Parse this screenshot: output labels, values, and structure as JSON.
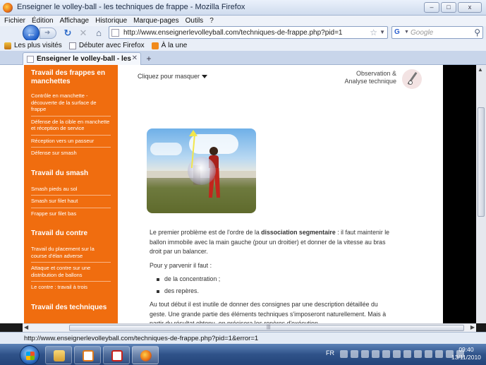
{
  "window": {
    "title": "Enseigner le volley-ball - les techniques de frappe - Mozilla Firefox",
    "buttons": {
      "minimize": "–",
      "maximize": "□",
      "close": "x"
    }
  },
  "menubar": {
    "items": [
      "Fichier",
      "Édition",
      "Affichage",
      "Historique",
      "Marque-pages",
      "Outils",
      "?"
    ]
  },
  "navigation": {
    "url": "http://www.enseignerlevolleyball.com/techniques-de-frappe.php?pid=1",
    "search_placeholder": "Google",
    "search_engine_glyph": "G"
  },
  "bookmarks": {
    "items": [
      "Les plus visités",
      "Débuter avec Firefox",
      "À la une"
    ]
  },
  "tabs": {
    "items": [
      {
        "label": "Enseigner le volley-ball - les techniqu..."
      }
    ],
    "new_tab": "+"
  },
  "sidebar": {
    "sections": [
      {
        "heading": "Travail des frappes en manchettes",
        "items": [
          "Contrôle en manchette - découverte de la surface de frappe",
          "Défense de la cible en manchette et réception de service",
          "Réception vers un passeur",
          "Défense sur smash"
        ]
      },
      {
        "heading": "Travail du smash",
        "items": [
          "Smash pieds au sol",
          "Smash sur filet haut",
          "Frappe sur filet bas"
        ]
      },
      {
        "heading": "Travail du contre",
        "items": [
          "Travail du placement sur la course d'élan adverse",
          "Attaque et contre sur une distribution de ballons",
          "Le contre : travail à trois"
        ]
      },
      {
        "heading": "Travail des techniques",
        "items": []
      }
    ]
  },
  "main": {
    "hide_link": "Cliquez pour masquer",
    "observation_title_line1": "Observation &",
    "observation_title_line2": "Analyse technique",
    "paragraph1_start": "Le premier problème est de l'ordre de la ",
    "paragraph1_bold": "dissociation segmentaire",
    "paragraph1_end": " : il faut maintenir le ballon immobile avec la main gauche (pour un droitier) et donner de la vitesse au bras droit par un balancer.",
    "paragraph2": "Pour y parvenir il faut :",
    "bullets": [
      "de la concentration ;",
      "des repères."
    ],
    "paragraph3": "Au tout début il est inutile de donner des consignes par une description détaillée du geste. Une grande partie des éléments techniques s'imposeront naturellement. Mais à partir du résultat obtenu, on précisera les repères d'exécution."
  },
  "statusbar": {
    "text": "http://www.enseignerlevolleyball.com/techniques-de-frappe.php?pid=1&error=1"
  },
  "taskbar": {
    "language": "FR",
    "time": "09:40",
    "date": "13/11/2010"
  }
}
